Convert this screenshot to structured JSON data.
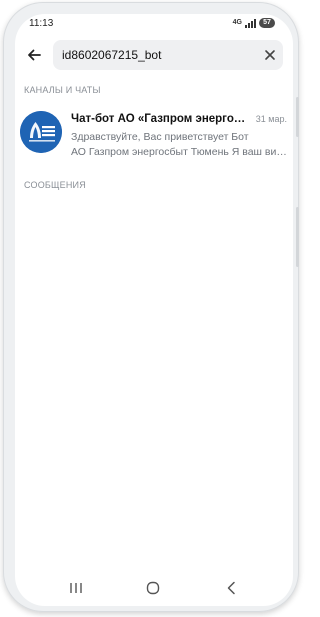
{
  "status_bar": {
    "time": "11:13",
    "network": "4G",
    "battery": "57"
  },
  "search": {
    "query": "id8602067215_bot"
  },
  "sections": {
    "chats_title": "КАНАЛЫ И ЧАТЫ",
    "messages_title": "СООБЩЕНИЯ"
  },
  "chat": {
    "name": "Чат-бот АО «Газпром энергосбыт Тюмень»",
    "date": "31 мар.",
    "preview_line1": "Здравствуйте, Вас приветствует Бот",
    "preview_line2": "АО Газпром энергосбыт Тюмень Я ваш виртуальный помощник",
    "avatar_logo_text": "ГАЗПРОМ ЭНЕРГОСБЫТ",
    "avatar_color": "#1f64b4"
  },
  "icons": {
    "back": "back-arrow-icon",
    "clear": "close-icon",
    "nav_recents": "recents-icon",
    "nav_home": "home-icon",
    "nav_back": "chevron-left-icon"
  }
}
